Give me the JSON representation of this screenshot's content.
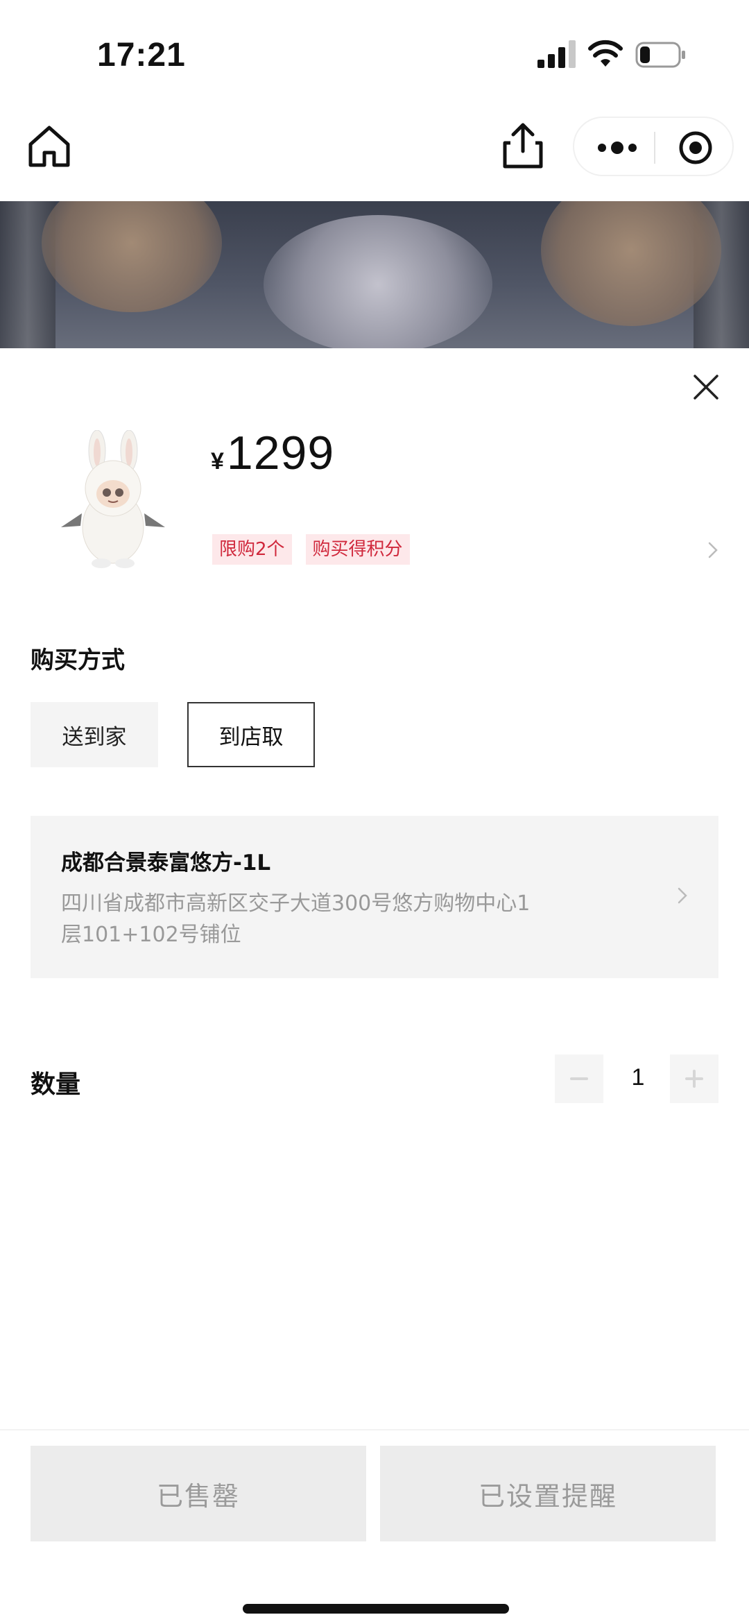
{
  "status_bar": {
    "time": "17:21",
    "icons": [
      "signal-icon",
      "wifi-icon",
      "battery-icon"
    ]
  },
  "nav_bar": {
    "icons": [
      "home-icon",
      "share-icon",
      "more-icon",
      "target-icon"
    ]
  },
  "product": {
    "currency": "¥",
    "price": "1299",
    "tags": [
      "限购2个",
      "购买得积分"
    ]
  },
  "purchase_method": {
    "title": "购买方式",
    "options": [
      "送到家",
      "到店取"
    ],
    "selected": "到店取"
  },
  "store": {
    "name": "成都合景泰富悠方-1L",
    "address": "四川省成都市高新区交子大道300号悠方购物中心1层101+102号铺位"
  },
  "quantity": {
    "label": "数量",
    "value": "1"
  },
  "bottom_actions": {
    "sold_out": "已售罄",
    "reminder": "已设置提醒"
  },
  "colors": {
    "tag_bg": "#fde8ea",
    "tag_text": "#d0283c",
    "disabled_bg": "#ececec",
    "disabled_text": "#9a9a9a"
  }
}
